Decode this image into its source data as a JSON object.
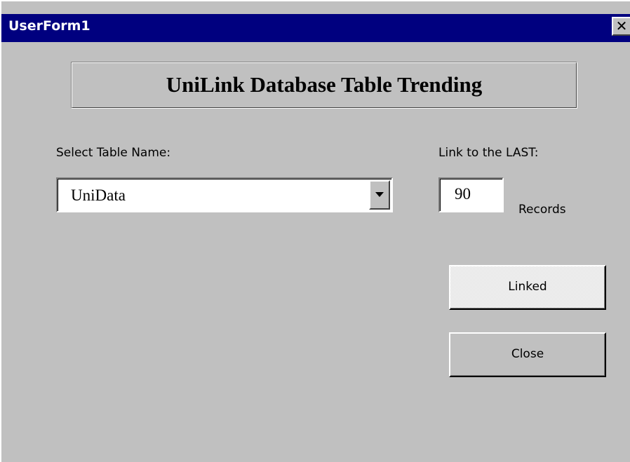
{
  "window": {
    "title": "UserForm1",
    "close_glyph": "✕"
  },
  "form": {
    "heading": "UniLink Database Table Trending",
    "select_table_label": "Select Table Name:",
    "selected_table": "UniData",
    "link_last_label": "Link to the LAST:",
    "records_count": "90",
    "records_unit": "Records",
    "linked_button_label": "Linked",
    "close_button_label": "Close"
  },
  "icons": {
    "title_close": "close-icon",
    "dropdown": "chevron-down-icon"
  },
  "colors": {
    "title_bar": "#00007f",
    "window_face": "#c0c0c0",
    "title_text": "#ffffff"
  }
}
